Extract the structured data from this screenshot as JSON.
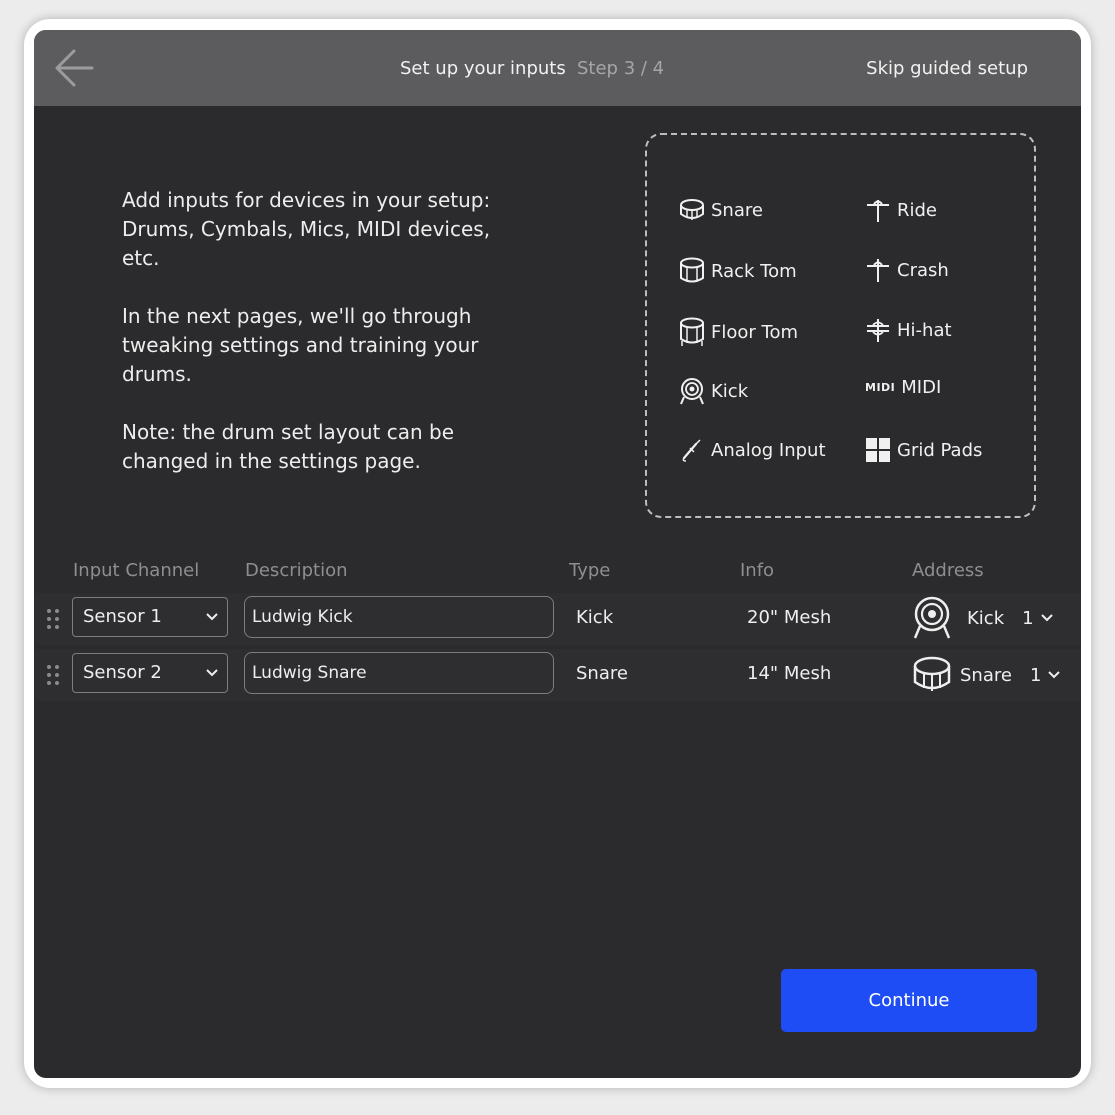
{
  "header": {
    "title": "Set up your inputs",
    "step": "Step 3 / 4",
    "skip_label": "Skip guided setup"
  },
  "intro": {
    "paragraph1": "Add inputs for devices in your setup: Drums, Cymbals, Mics, MIDI devices, etc.",
    "paragraph2": "In the next pages, we'll go through tweaking settings and training your drums.",
    "paragraph3": "Note: the drum set layout can be changed in the settings page."
  },
  "legend": {
    "items": [
      {
        "label": "Snare",
        "icon": "snare-icon"
      },
      {
        "label": "Ride",
        "icon": "ride-cymbal-icon"
      },
      {
        "label": "Rack Tom",
        "icon": "rack-tom-icon"
      },
      {
        "label": "Crash",
        "icon": "crash-cymbal-icon"
      },
      {
        "label": "Floor Tom",
        "icon": "floor-tom-icon"
      },
      {
        "label": "Hi-hat",
        "icon": "hihat-icon"
      },
      {
        "label": "Kick",
        "icon": "kick-icon"
      },
      {
        "label": "MIDI",
        "icon": "midi-icon",
        "tag": "MIDI"
      },
      {
        "label": "Analog Input",
        "icon": "analog-input-icon"
      },
      {
        "label": "Grid Pads",
        "icon": "grid-pads-icon"
      }
    ]
  },
  "table": {
    "headers": [
      "Input Channel",
      "Description",
      "Type",
      "Info",
      "Address"
    ],
    "rows": [
      {
        "channel": "Sensor 1",
        "description": "Ludwig Kick",
        "type": "Kick",
        "info": "20\" Mesh",
        "address_label": "Kick",
        "address_num": "1",
        "address_icon": "kick-icon"
      },
      {
        "channel": "Sensor 2",
        "description": "Ludwig Snare",
        "type": "Snare",
        "info": "14\" Mesh",
        "address_label": "Snare",
        "address_num": "1",
        "address_icon": "snare-icon"
      }
    ]
  },
  "footer": {
    "continue_label": "Continue"
  },
  "colors": {
    "background": "#2b2b2d",
    "topbar": "#5c5c5e",
    "accent": "#1e4df5"
  }
}
